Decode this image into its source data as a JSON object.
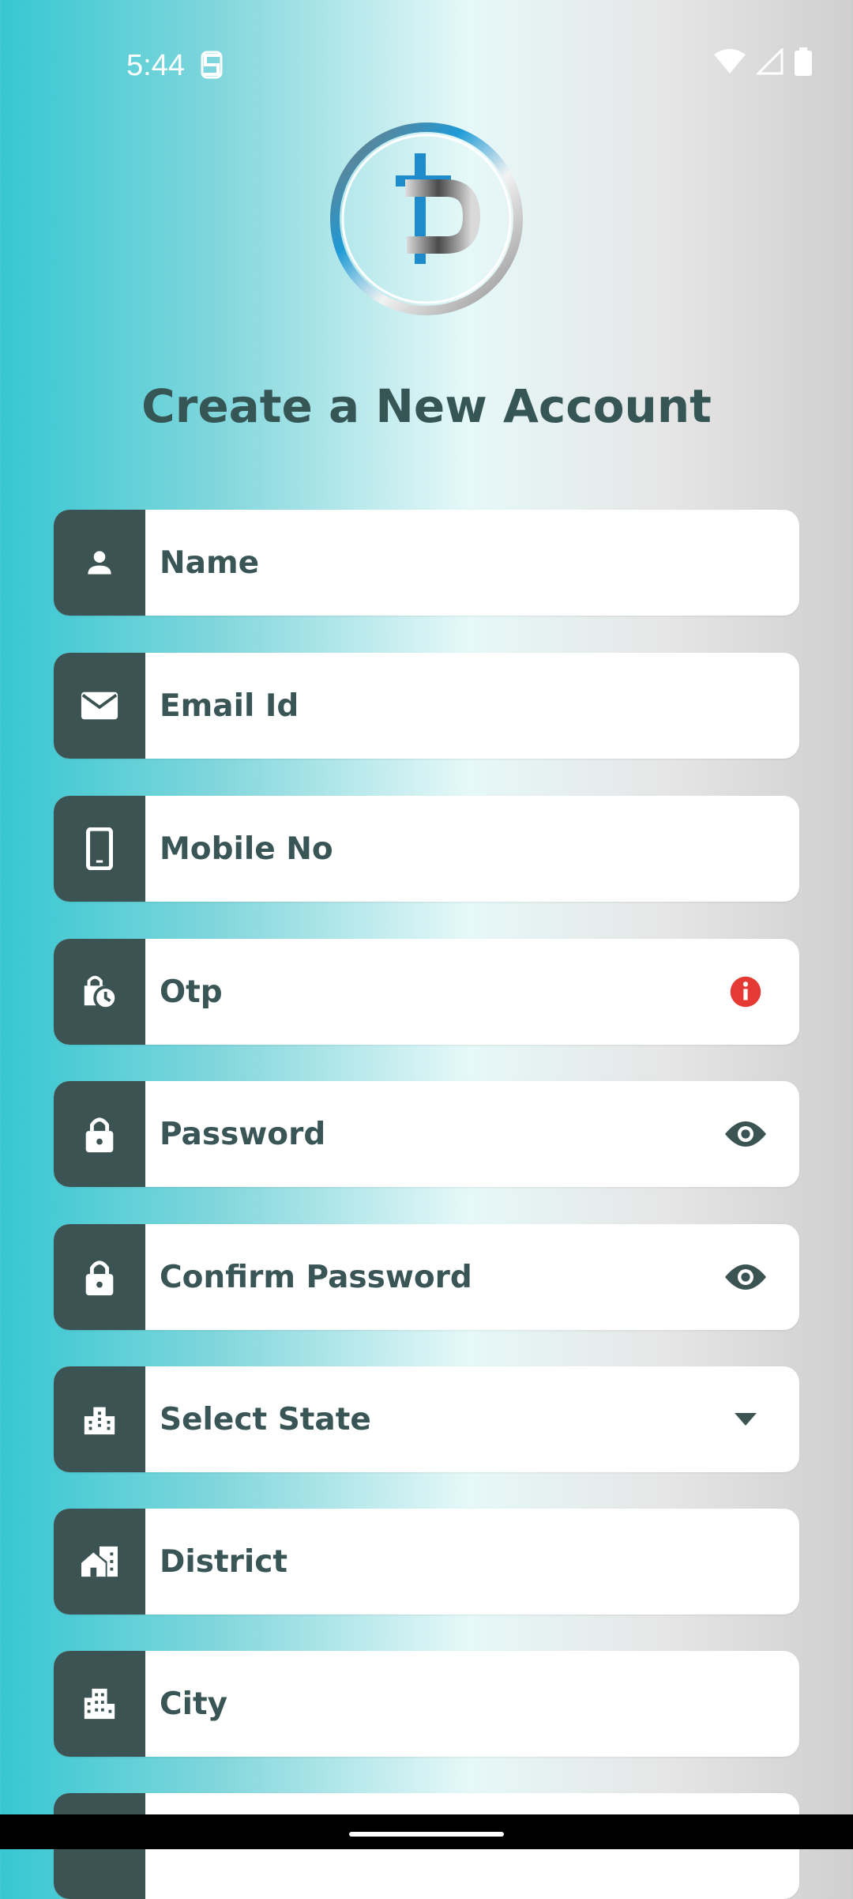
{
  "status": {
    "time": "5:44"
  },
  "title": "Create a New Account",
  "fields": [
    {
      "label": "Name",
      "icon": "person-icon"
    },
    {
      "label": "Email Id",
      "icon": "mail-icon"
    },
    {
      "label": "Mobile No",
      "icon": "phone-icon"
    },
    {
      "label": "Otp",
      "icon": "timer-lock-icon",
      "trailing": "error-icon"
    },
    {
      "label": "Password",
      "icon": "lock-icon",
      "trailing": "eye-icon"
    },
    {
      "label": "Confirm Password",
      "icon": "lock-icon",
      "trailing": "eye-icon"
    },
    {
      "label": "Select State",
      "icon": "building-icon",
      "trailing": "dropdown-arrow-icon"
    },
    {
      "label": "District",
      "icon": "home-building-icon"
    },
    {
      "label": "City",
      "icon": "city-icon"
    },
    {
      "label": ""
    }
  ],
  "colors": {
    "icon_box": "#3b5353",
    "text": "#395555",
    "error": "#e53935"
  }
}
